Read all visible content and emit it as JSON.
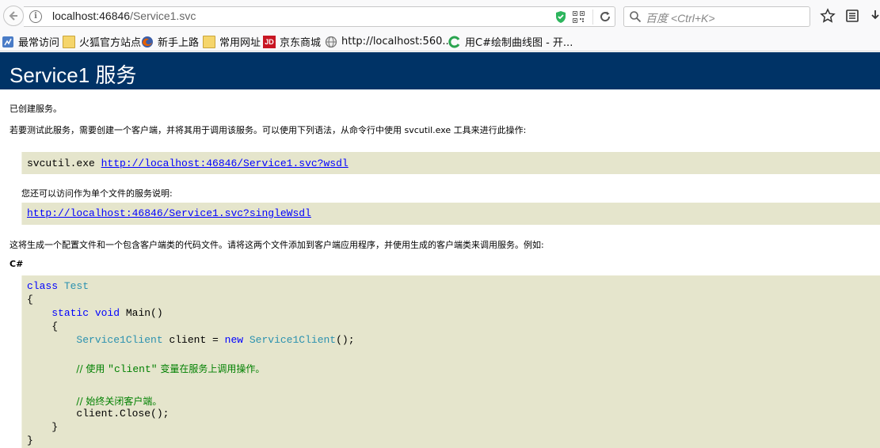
{
  "browser": {
    "url_host": "localhost:46846",
    "url_path": "/Service1.svc",
    "search_placeholder": "百度 <Ctrl+K>"
  },
  "bookmarks": [
    {
      "label": "最常访问",
      "icon": "most-visited-icon"
    },
    {
      "label": "火狐官方站点",
      "icon": "folder-icon"
    },
    {
      "label": "新手上路",
      "icon": "firefox-icon"
    },
    {
      "label": "常用网址",
      "icon": "folder-icon"
    },
    {
      "label": "京东商城",
      "icon": "jd-icon"
    },
    {
      "label": "http://localhost:560...",
      "icon": "globe-icon"
    },
    {
      "label": "用C#绘制曲线图 - 开...",
      "icon": "cnblogs-icon"
    }
  ],
  "page": {
    "title": "Service1 服务",
    "created": "已创建服务。",
    "intro": "若要测试此服务，需要创建一个客户端，并将其用于调用该服务。可以使用下列语法，从命令行中使用 svcutil.exe 工具来进行此操作:",
    "svcutil_cmd": "svcutil.exe ",
    "wsdl_link": "http://localhost:46846/Service1.svc?wsdl",
    "single_file_text": "您还可以访问作为单个文件的服务说明:",
    "single_wsdl_link": "http://localhost:46846/Service1.svc?singleWsdl",
    "generate_text": "这将生成一个配置文件和一个包含客户端类的代码文件。请将这两个文件添加到客户端应用程序，并使用生成的客户端类来调用服务。例如:",
    "csharp_heading": "C#"
  },
  "code": {
    "kw_class": "class",
    "class_name": "Test",
    "open_brace": "{",
    "kw_static_void": "static void",
    "method": " Main()",
    "inner_open": "{",
    "client_type": "Service1Client",
    "client_decl": " client = ",
    "kw_new": "new",
    "client_type2": "Service1Client",
    "ctor_end": "();",
    "comment1_prefix": "// 使用 ",
    "comment1_literal": "\"client\"",
    "comment1_suffix": " 变量在服务上调用操作。",
    "comment2": "// 始终关闭客户端。",
    "close_call": "client.Close();",
    "inner_close": "}",
    "close_brace": "}"
  }
}
